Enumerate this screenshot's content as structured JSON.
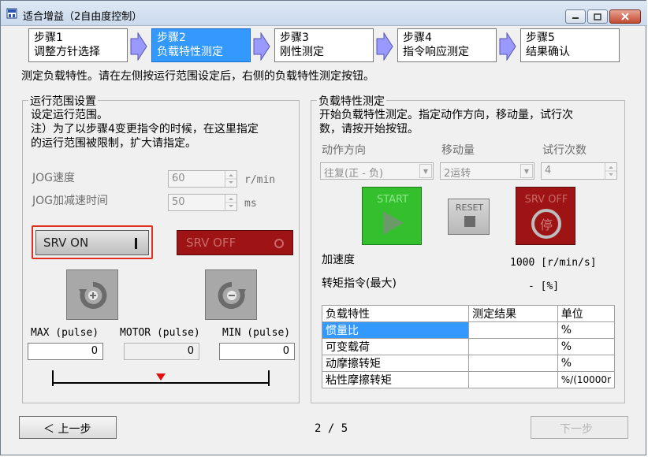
{
  "window": {
    "title": "适合增益（2自由度控制）"
  },
  "steps": [
    {
      "line1": "步骤1",
      "line2": "调整方针选择"
    },
    {
      "line1": "步骤2",
      "line2": "负载特性测定"
    },
    {
      "line1": "步骤3",
      "line2": "刚性测定"
    },
    {
      "line1": "步骤4",
      "line2": "指令响应测定"
    },
    {
      "line1": "步骤5",
      "line2": "结果确认"
    }
  ],
  "description": "测定负载特性。请在左侧按运行范围设定后，右侧的负载特性测定按钮。",
  "left_group": {
    "title": "运行范围设置",
    "line1": "设定运行范围。",
    "line2": "注）为了以步骤4变更指令的时候，在这里指定",
    "line3": "的运行范围被限制，扩大请指定。",
    "jog_speed_label": "JOG速度",
    "jog_speed_value": "60",
    "jog_speed_unit": "r/min",
    "jog_accel_label": "JOG加减速时间",
    "jog_accel_value": "50",
    "jog_accel_unit": "ms",
    "srv_on_label": "SRV ON",
    "srv_off_label": "SRV OFF",
    "max_label": "MAX (pulse)",
    "motor_label": "MOTOR (pulse)",
    "min_label": "MIN (pulse)",
    "max_value": "0",
    "motor_value": "0",
    "min_value": "0"
  },
  "right_group": {
    "title": "负载特性测定",
    "line1": "开始负载特性测定。指定动作方向，移动量，试行次",
    "line2": "数，请按开始按钮。",
    "direction_label": "动作方向",
    "move_label": "移动量",
    "trials_label": "试行次数",
    "direction_value": "往复(正 - 负)",
    "move_value": "2运转",
    "trials_value": "4",
    "start_label": "START",
    "reset_label": "RESET",
    "srv_off_label": "SRV OFF",
    "stop_glyph": "停",
    "accel_label": "加速度",
    "accel_value": "1000 [r/min/s]",
    "torque_label": "转矩指令(最大)",
    "torque_value": "- [%]",
    "table": {
      "headers": [
        "负载特性",
        "测定结果",
        "单位"
      ],
      "rows": [
        {
          "name": "惯量比",
          "result": "",
          "unit": "%"
        },
        {
          "name": "可变载荷",
          "result": "",
          "unit": "%"
        },
        {
          "name": "动摩擦转矩",
          "result": "",
          "unit": "%"
        },
        {
          "name": "粘性摩擦转矩",
          "result": "",
          "unit": "%/(10000r"
        }
      ]
    }
  },
  "footer": {
    "back_label": "＜ 上一步",
    "page_indicator": "2 / 5",
    "next_label": "下一步"
  },
  "colors": {
    "step_active": "#3399ff",
    "srv_on_highlight": "#e0301e",
    "srv_off_red": "#9e1313",
    "start_green": "#33c02c",
    "selected_row": "#3399ff"
  }
}
